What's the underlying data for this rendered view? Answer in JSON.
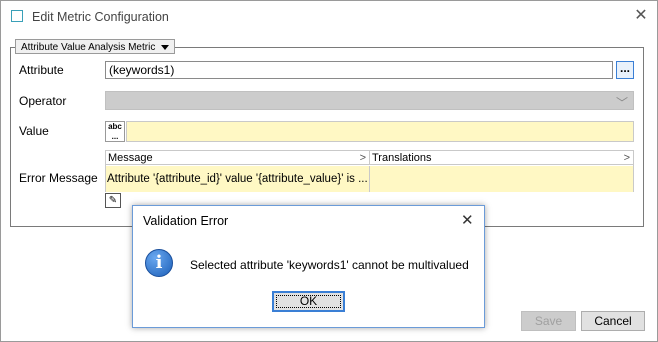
{
  "window": {
    "title": "Edit Metric Configuration",
    "icon": "window-icon",
    "close_icon": "close-icon"
  },
  "metric_type": {
    "label": "Attribute Value Analysis Metric"
  },
  "form": {
    "attribute_label": "Attribute",
    "attribute_value": "(keywords1)",
    "browse_label": "...",
    "operator_label": "Operator",
    "operator_value": "",
    "value_label": "Value",
    "value_type_icon": "abc",
    "value_input": "",
    "error_message_label": "Error Message",
    "grid_headers": [
      "Message",
      "Translations"
    ],
    "grid_row": {
      "message": "Attribute '{attribute_id}' value '{attribute_value}' is ...",
      "translations": ""
    }
  },
  "buttons": {
    "save": "Save",
    "cancel": "Cancel"
  },
  "dialog": {
    "title": "Validation Error",
    "message": "Selected attribute 'keywords1' cannot be multivalued",
    "ok": "OK",
    "icon": "info-icon"
  },
  "colors": {
    "accent": "#3a7fd5",
    "highlight_field": "#fff8c4",
    "disabled_field": "#cccccc"
  }
}
